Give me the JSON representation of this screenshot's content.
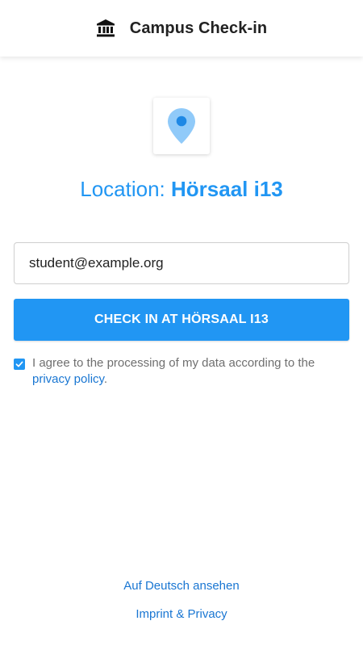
{
  "header": {
    "icon": "bank-icon",
    "title": "Campus Check-in"
  },
  "location": {
    "icon": "map-pin-icon",
    "prefix": "Location: ",
    "name": "Hörsaal i13"
  },
  "form": {
    "email_value": "student@example.org",
    "checkin_label": "CHECK IN AT HÖRSAAL I13",
    "consent_checked": true,
    "consent_text": "I agree to the processing of my data according to the ",
    "privacy_link": "privacy policy",
    "consent_end": "."
  },
  "footer": {
    "language_link": "Auf Deutsch ansehen",
    "imprint_link": "Imprint & Privacy"
  },
  "colors": {
    "accent": "#2196f3",
    "link": "#1976d2",
    "pin_light": "#90caf9"
  }
}
